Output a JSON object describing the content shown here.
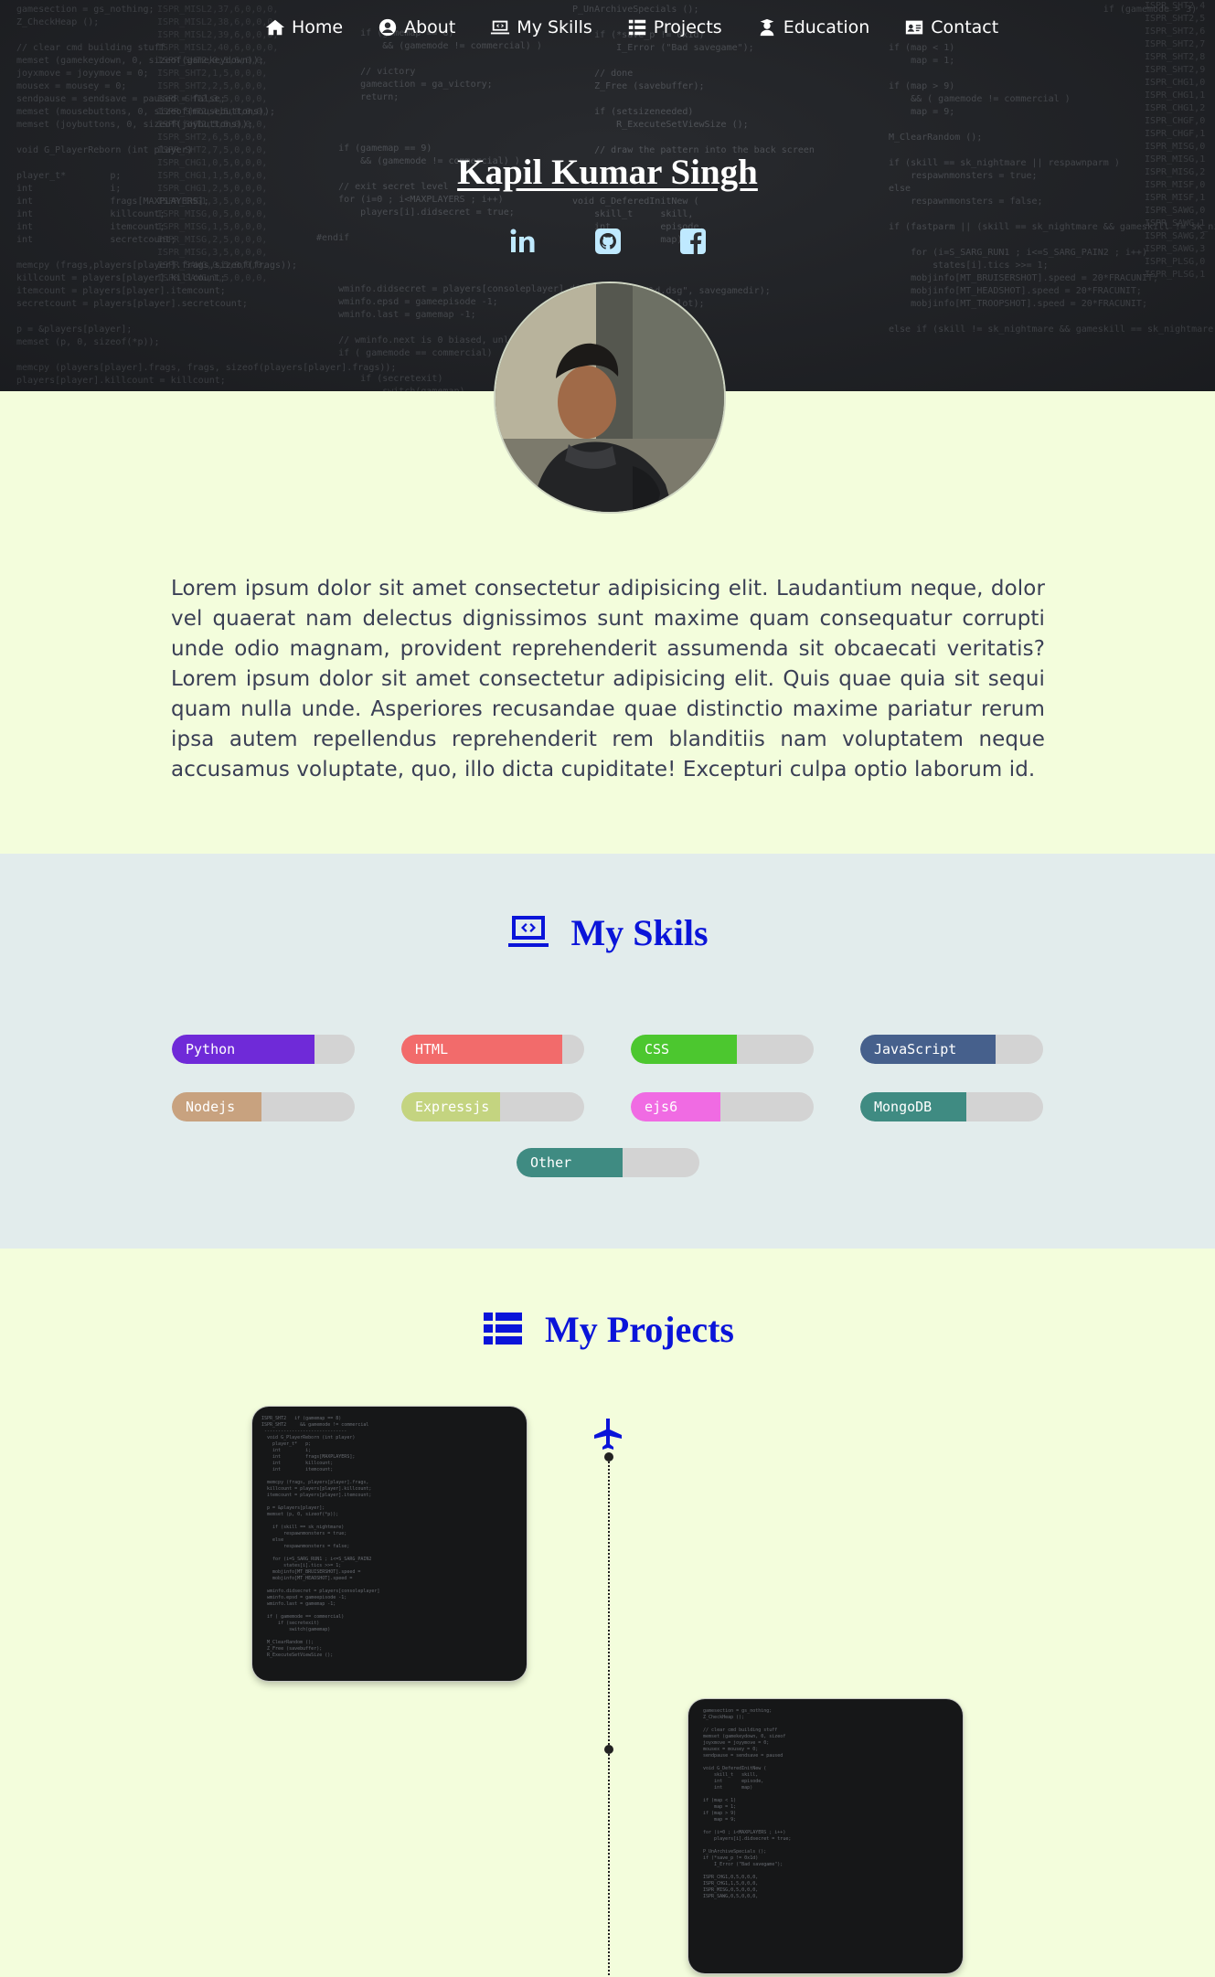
{
  "nav": {
    "items": [
      {
        "label": "Home",
        "icon": "home-icon"
      },
      {
        "label": "About",
        "icon": "user-circle-icon"
      },
      {
        "label": "My Skills",
        "icon": "laptop-code-icon"
      },
      {
        "label": "Projects",
        "icon": "table-list-icon"
      },
      {
        "label": "Education",
        "icon": "graduate-icon"
      },
      {
        "label": "Contact",
        "icon": "id-card-icon"
      }
    ]
  },
  "hero": {
    "name": "Kapil Kumar Singh",
    "socials": [
      {
        "icon": "linkedin-icon"
      },
      {
        "icon": "github-icon"
      },
      {
        "icon": "facebook-icon"
      }
    ],
    "social_color": "#bfe9ff"
  },
  "about": {
    "text": "Lorem ipsum dolor sit amet consectetur adipisicing elit. Laudantium neque, dolor vel quaerat nam delectus dignissimos sunt maxime quam consequatur corrupti unde odio magnam, provident reprehenderit assumenda sit obcaecati veritatis? Lorem ipsum dolor sit amet consectetur adipisicing elit. Quis quae quia sit sequi quam nulla unde. Asperiores recusandae quae distinctio maxime pariatur rerum ipsa autem repellendus reprehenderit rem blanditiis nam voluptatem neque accusamus voluptate, quo, illo dicta cupiditate! Excepturi culpa optio laborum id."
  },
  "skills": {
    "title": "My Skils",
    "items": [
      {
        "label": "Python",
        "level": 0.78,
        "color": "#6f2ad8"
      },
      {
        "label": "HTML",
        "level": 0.88,
        "color": "#f26b6b"
      },
      {
        "label": "CSS",
        "level": 0.58,
        "color": "#4cc72f"
      },
      {
        "label": "JavaScript",
        "level": 0.74,
        "color": "#46608c"
      },
      {
        "label": "Nodejs",
        "level": 0.49,
        "color": "#c8a27f"
      },
      {
        "label": "Expressjs",
        "level": 0.54,
        "color": "#c4d480"
      },
      {
        "label": "ejs6",
        "level": 0.49,
        "color": "#f06be3"
      },
      {
        "label": "MongoDB",
        "level": 0.58,
        "color": "#3f8b82"
      },
      {
        "label": "Other",
        "level": 0.58,
        "color": "#3f8b82"
      }
    ]
  },
  "projects": {
    "title": "My Projects"
  }
}
